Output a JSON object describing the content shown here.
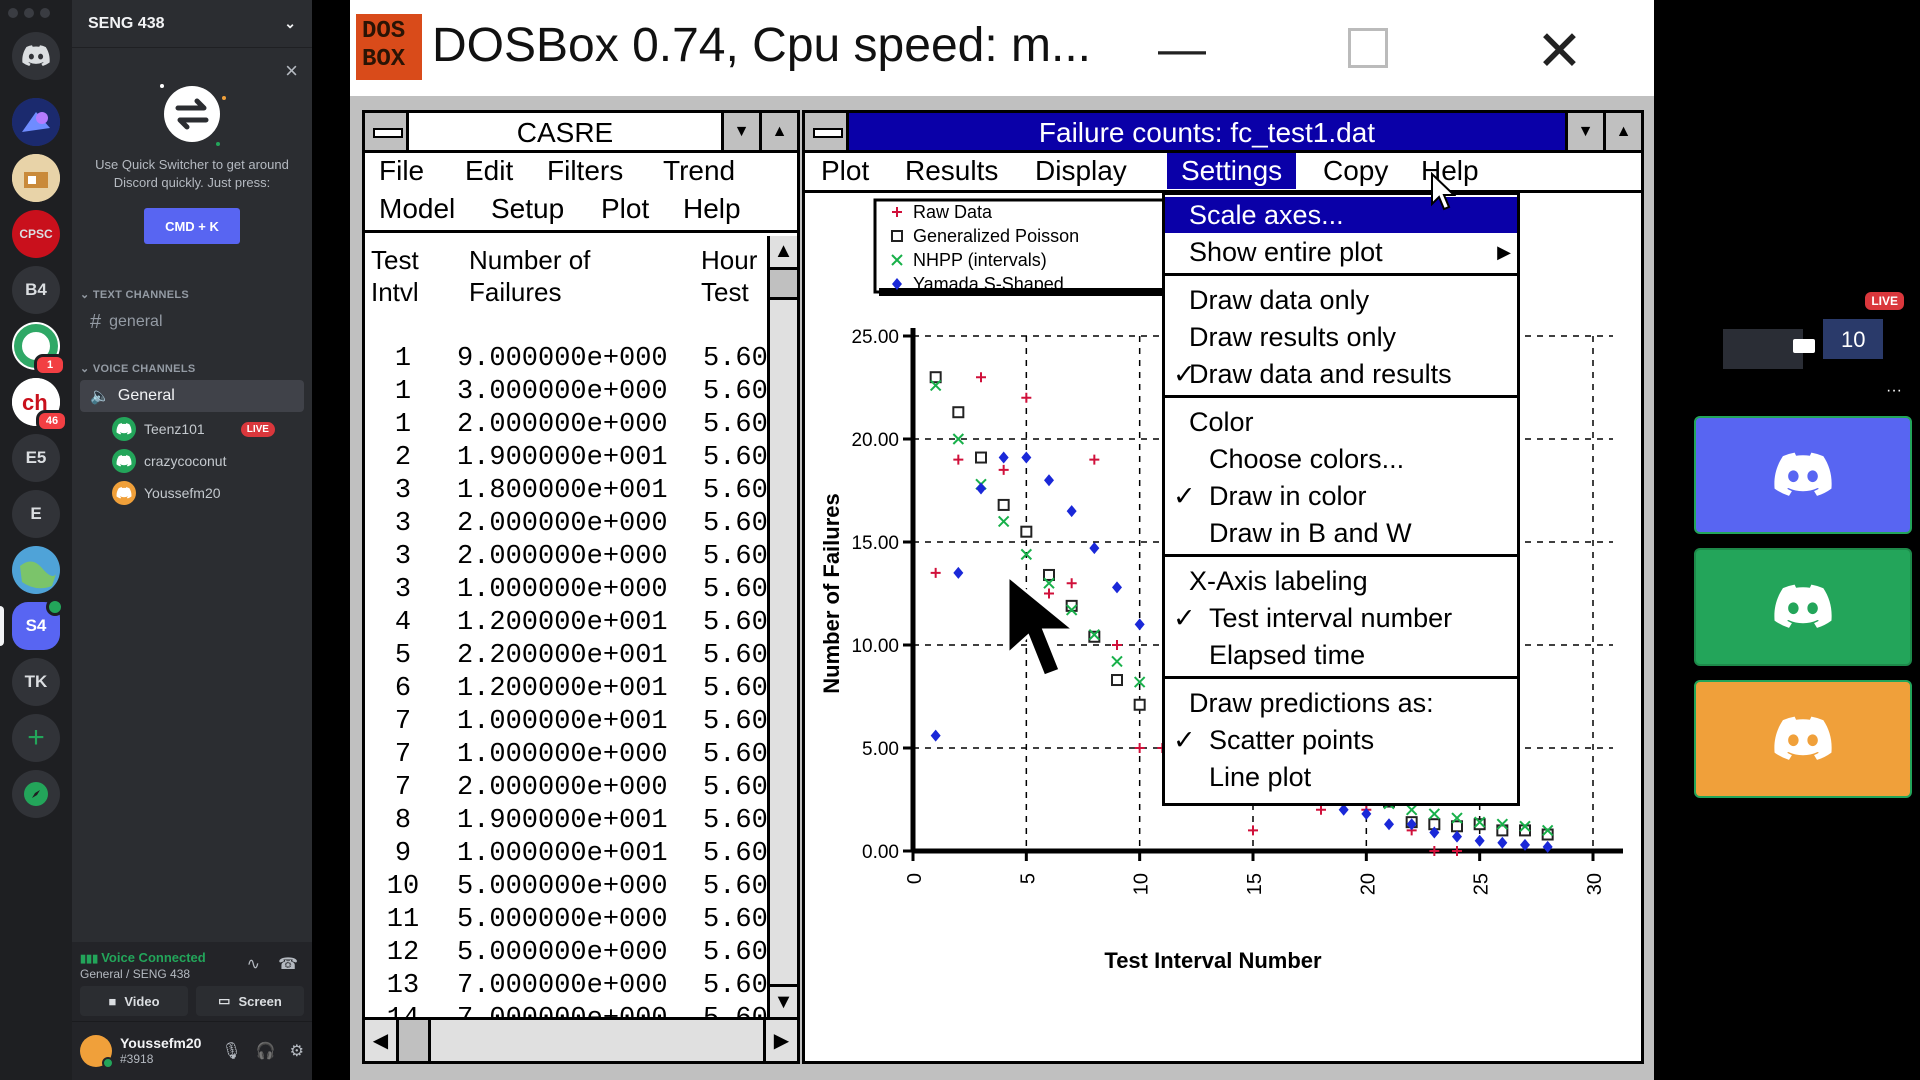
{
  "discord": {
    "server_name": "SENG 438",
    "servers": [
      {
        "label": "",
        "icon": "discord-home-icon"
      },
      {
        "label": "",
        "icon": "server-avatar-1"
      },
      {
        "label": "",
        "icon": "server-avatar-2"
      },
      {
        "label": "CPSC",
        "icon": "server-avatar-cpsc"
      },
      {
        "label": "B4"
      },
      {
        "label": "",
        "icon": "server-avatar-ring",
        "badge": "1"
      },
      {
        "label": "",
        "icon": "server-avatar-ch",
        "badge": "46"
      },
      {
        "label": "E5"
      },
      {
        "label": "E"
      },
      {
        "label": "",
        "icon": "server-avatar-globe"
      },
      {
        "label": "S4"
      },
      {
        "label": "TK"
      }
    ],
    "quick_switcher": {
      "text": "Use Quick Switcher to get around Discord quickly. Just press:",
      "button": "CMD + K"
    },
    "text_channels_header": "TEXT CHANNELS",
    "text_channel": "general",
    "voice_channels_header": "VOICE CHANNELS",
    "voice_channel": "General",
    "voice_users": [
      {
        "name": "Teenz101",
        "live": "LIVE",
        "color": "#23a55a"
      },
      {
        "name": "crazycoconut",
        "live": "",
        "color": "#23a55a"
      },
      {
        "name": "Youssefm20",
        "live": "",
        "color": "#f0a03a"
      }
    ],
    "voice_connected": "Voice Connected",
    "voice_location": "General / SENG 438",
    "video_label": "Video",
    "screen_label": "Screen",
    "user": {
      "name": "Youssefm20",
      "tag": "#3918"
    }
  },
  "dosbox": {
    "logo": "DOS\nBOX",
    "title": "DOSBox 0.74, Cpu speed: m..."
  },
  "casre": {
    "title": "CASRE",
    "menu_row1": [
      "File",
      "Edit",
      "Filters",
      "Trend"
    ],
    "menu_row2": [
      "Model",
      "Setup",
      "Plot",
      "Help"
    ],
    "columns": [
      "Test\nIntvl",
      "Number of\nFailures",
      "Hour\nTest"
    ],
    "rows": [
      [
        "1",
        "9.000000e+000",
        "5.60"
      ],
      [
        "1",
        "3.000000e+000",
        "5.60"
      ],
      [
        "1",
        "2.000000e+000",
        "5.60"
      ],
      [
        "2",
        "1.900000e+001",
        "5.60"
      ],
      [
        "3",
        "1.800000e+001",
        "5.60"
      ],
      [
        "3",
        "2.000000e+000",
        "5.60"
      ],
      [
        "3",
        "2.000000e+000",
        "5.60"
      ],
      [
        "3",
        "1.000000e+000",
        "5.60"
      ],
      [
        "4",
        "1.200000e+001",
        "5.60"
      ],
      [
        "5",
        "2.200000e+001",
        "5.60"
      ],
      [
        "6",
        "1.200000e+001",
        "5.60"
      ],
      [
        "7",
        "1.000000e+001",
        "5.60"
      ],
      [
        "7",
        "1.000000e+000",
        "5.60"
      ],
      [
        "7",
        "2.000000e+000",
        "5.60"
      ],
      [
        "8",
        "1.900000e+001",
        "5.60"
      ],
      [
        "9",
        "1.000000e+001",
        "5.60"
      ],
      [
        "10",
        "5.000000e+000",
        "5.60"
      ],
      [
        "11",
        "5.000000e+000",
        "5.60"
      ],
      [
        "12",
        "5.000000e+000",
        "5.60"
      ],
      [
        "13",
        "7.000000e+000",
        "5.60"
      ],
      [
        "14",
        "7.000000e+000",
        "5.60"
      ]
    ]
  },
  "plotwin": {
    "title": "Failure counts:  fc_test1.dat",
    "menu": [
      "Plot",
      "Results",
      "Display",
      "Settings",
      "Copy",
      "Help"
    ],
    "selected_menu": "Settings"
  },
  "settings_menu": {
    "items": [
      {
        "label": "Scale axes...",
        "check": "",
        "selected": true,
        "indent": false,
        "arrow": ""
      },
      {
        "label": "Show entire plot",
        "check": "",
        "selected": false,
        "indent": false,
        "arrow": "▶"
      },
      {
        "sep": true
      },
      {
        "label": "Draw data only",
        "check": "",
        "selected": false,
        "indent": false,
        "arrow": ""
      },
      {
        "label": "Draw results only",
        "check": "",
        "selected": false,
        "indent": false,
        "arrow": ""
      },
      {
        "label": "Draw data and results",
        "check": "✓",
        "selected": false,
        "indent": false,
        "arrow": ""
      },
      {
        "sep": true
      },
      {
        "label": "Color",
        "check": "",
        "selected": false,
        "indent": false,
        "arrow": ""
      },
      {
        "label": "Choose colors...",
        "check": "",
        "selected": false,
        "indent": true,
        "arrow": ""
      },
      {
        "label": "Draw in color",
        "check": "✓",
        "selected": false,
        "indent": true,
        "arrow": ""
      },
      {
        "label": "Draw in B and W",
        "check": "",
        "selected": false,
        "indent": true,
        "arrow": ""
      },
      {
        "sep": true
      },
      {
        "label": "X-Axis labeling",
        "check": "",
        "selected": false,
        "indent": false,
        "arrow": ""
      },
      {
        "label": "Test interval number",
        "check": "✓",
        "selected": false,
        "indent": true,
        "arrow": ""
      },
      {
        "label": "Elapsed time",
        "check": "",
        "selected": false,
        "indent": true,
        "arrow": ""
      },
      {
        "sep": true
      },
      {
        "label": "Draw predictions as:",
        "check": "",
        "selected": false,
        "indent": false,
        "arrow": ""
      },
      {
        "label": "Scatter points",
        "check": "✓",
        "selected": false,
        "indent": true,
        "arrow": ""
      },
      {
        "label": "Line plot",
        "check": "",
        "selected": false,
        "indent": true,
        "arrow": ""
      }
    ]
  },
  "chart_data": {
    "type": "scatter",
    "xlabel": "Test Interval Number",
    "ylabel": "Number of Failures",
    "xlim": [
      0,
      30
    ],
    "ylim": [
      0,
      25
    ],
    "xticks": [
      "0",
      "5",
      "10",
      "15",
      "20",
      "25",
      "30"
    ],
    "yticks": [
      "0.00",
      "5.00",
      "10.00",
      "15.00",
      "20.00",
      "25.00"
    ],
    "grid": true,
    "legend_position": "top-left",
    "series": [
      {
        "name": "Raw Data",
        "marker": "+",
        "color": "#d0103a",
        "points": [
          [
            1,
            13.5
          ],
          [
            2,
            19
          ],
          [
            3,
            23
          ],
          [
            4,
            18.5
          ],
          [
            5,
            22
          ],
          [
            6,
            12.5
          ],
          [
            7,
            13
          ],
          [
            8,
            19
          ],
          [
            9,
            10
          ],
          [
            10,
            5
          ],
          [
            11,
            5
          ],
          [
            12,
            5
          ],
          [
            15,
            1
          ],
          [
            16,
            3
          ],
          [
            18,
            2
          ],
          [
            20,
            2
          ],
          [
            22,
            1
          ],
          [
            23,
            0
          ],
          [
            24,
            0
          ],
          [
            25,
            3
          ],
          [
            26,
            1
          ],
          [
            27,
            1
          ]
        ]
      },
      {
        "name": "Generalized Poisson",
        "marker": "square",
        "color": "#222222",
        "points": [
          [
            1,
            23
          ],
          [
            2,
            21.3
          ],
          [
            3,
            19.1
          ],
          [
            4,
            16.8
          ],
          [
            5,
            15.5
          ],
          [
            6,
            13.4
          ],
          [
            7,
            11.9
          ],
          [
            8,
            10.4
          ],
          [
            9,
            8.3
          ],
          [
            10,
            7.1
          ],
          [
            12,
            6
          ],
          [
            13,
            5.5
          ],
          [
            14,
            4.9
          ],
          [
            15,
            3.9
          ],
          [
            16,
            3.6
          ],
          [
            17,
            3.3
          ],
          [
            18,
            3.1
          ],
          [
            19,
            2.8
          ],
          [
            20,
            2.6
          ],
          [
            21,
            2.4
          ],
          [
            22,
            1.4
          ],
          [
            23,
            1.3
          ],
          [
            24,
            1.2
          ],
          [
            25,
            1.3
          ],
          [
            26,
            1
          ],
          [
            27,
            1
          ],
          [
            28,
            0.8
          ]
        ]
      },
      {
        "name": "NHPP (intervals)",
        "marker": "x",
        "color": "#18b04a",
        "points": [
          [
            1,
            22.6
          ],
          [
            2,
            20
          ],
          [
            3,
            17.8
          ],
          [
            4,
            16
          ],
          [
            5,
            14.4
          ],
          [
            6,
            13
          ],
          [
            7,
            11.7
          ],
          [
            8,
            10.5
          ],
          [
            9,
            9.2
          ],
          [
            10,
            8.2
          ],
          [
            12,
            6.7
          ],
          [
            13,
            5.9
          ],
          [
            14,
            5.3
          ],
          [
            15,
            4.6
          ],
          [
            16,
            4.1
          ],
          [
            17,
            3.6
          ],
          [
            18,
            3.2
          ],
          [
            19,
            2.9
          ],
          [
            20,
            2.6
          ],
          [
            21,
            2.3
          ],
          [
            22,
            2
          ],
          [
            23,
            1.8
          ],
          [
            24,
            1.6
          ],
          [
            25,
            1.4
          ],
          [
            26,
            1.3
          ],
          [
            27,
            1.2
          ],
          [
            28,
            1
          ]
        ]
      },
      {
        "name": "Yamada S-Shaped",
        "marker": "diamond",
        "color": "#1a28d8",
        "points": [
          [
            1,
            5.6
          ],
          [
            2,
            13.5
          ],
          [
            3,
            17.6
          ],
          [
            4,
            19.1
          ],
          [
            5,
            19.1
          ],
          [
            6,
            18
          ],
          [
            7,
            16.5
          ],
          [
            8,
            14.7
          ],
          [
            9,
            12.8
          ],
          [
            10,
            11
          ],
          [
            14,
            5.5
          ],
          [
            15,
            4.3
          ],
          [
            16,
            3.6
          ],
          [
            17,
            3
          ],
          [
            18,
            2.5
          ],
          [
            19,
            2
          ],
          [
            20,
            1.8
          ],
          [
            21,
            1.3
          ],
          [
            22,
            1.3
          ],
          [
            23,
            0.9
          ],
          [
            24,
            0.7
          ],
          [
            25,
            0.5
          ],
          [
            26,
            0.4
          ],
          [
            27,
            0.3
          ],
          [
            28,
            0.2
          ]
        ]
      }
    ]
  },
  "video_tiles": [
    {
      "label": "LIVE",
      "color": "#000000"
    },
    {
      "label": "",
      "color": "#5865f2"
    },
    {
      "label": "",
      "color": "#23a55a"
    },
    {
      "label": "",
      "color": "#f0a03a"
    }
  ]
}
